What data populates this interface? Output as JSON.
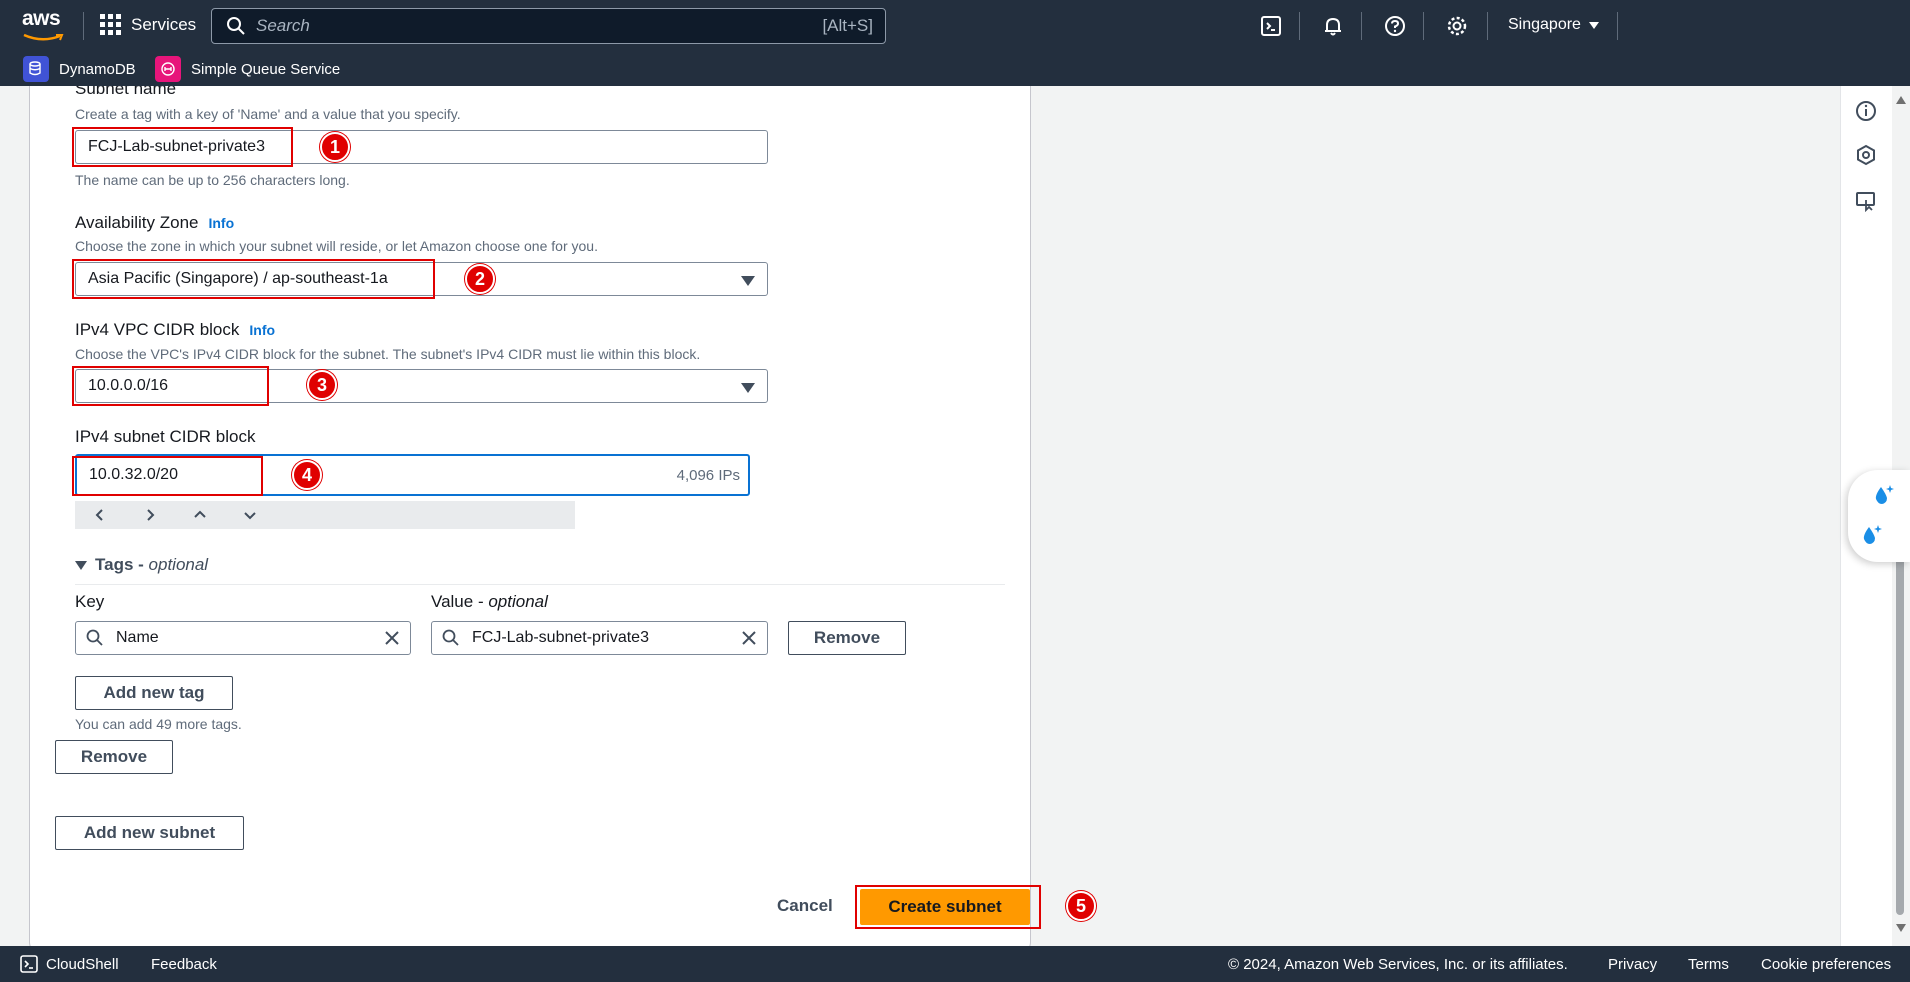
{
  "topnav": {
    "logo_text": "aws",
    "services_label": "Services",
    "search_placeholder": "Search",
    "search_shortcut": "[Alt+S]",
    "region": "Singapore"
  },
  "favorites": [
    {
      "label": "DynamoDB",
      "color": "#4053d6"
    },
    {
      "label": "Simple Queue Service",
      "color": "#e7157b"
    }
  ],
  "form": {
    "subnet_name_label": "Subnet name",
    "subnet_name_desc": "Create a tag with a key of 'Name' and a value that you specify.",
    "subnet_name_value": "FCJ-Lab-subnet-private3",
    "subnet_name_hint": "The name can be up to 256 characters long.",
    "az_label": "Availability Zone",
    "az_info": "Info",
    "az_desc": "Choose the zone in which your subnet will reside, or let Amazon choose one for you.",
    "az_value": "Asia Pacific (Singapore) / ap-southeast-1a",
    "vpc_cidr_label": "IPv4 VPC CIDR block",
    "vpc_cidr_info": "Info",
    "vpc_cidr_desc": "Choose the VPC's IPv4 CIDR block for the subnet. The subnet's IPv4 CIDR must lie within this block.",
    "vpc_cidr_value": "10.0.0.0/16",
    "subnet_cidr_label": "IPv4 subnet CIDR block",
    "subnet_cidr_value": "10.0.32.0/20",
    "subnet_cidr_ips": "4,096 IPs"
  },
  "tags": {
    "section_label": "Tags - ",
    "section_optional": "optional",
    "key_header": "Key",
    "value_header": "Value - ",
    "value_optional": "optional",
    "key_value": "Name",
    "value_value": "FCJ-Lab-subnet-private3",
    "remove_tag_label": "Remove",
    "add_tag_label": "Add new tag",
    "tags_left": "You can add 49 more tags."
  },
  "subnet_actions": {
    "remove_subnet_label": "Remove",
    "add_subnet_label": "Add new subnet"
  },
  "footer_actions": {
    "cancel_label": "Cancel",
    "create_label": "Create subnet"
  },
  "annotations": [
    "1",
    "2",
    "3",
    "4",
    "5"
  ],
  "footer": {
    "cloudshell": "CloudShell",
    "feedback": "Feedback",
    "copyright": "© 2024, Amazon Web Services, Inc. or its affiliates.",
    "privacy": "Privacy",
    "terms": "Terms",
    "cookie": "Cookie preferences"
  },
  "colors": {
    "nav_bg": "#232f3e",
    "primary": "#ff9900",
    "link": "#0972d3",
    "annotation": "#e00000"
  }
}
